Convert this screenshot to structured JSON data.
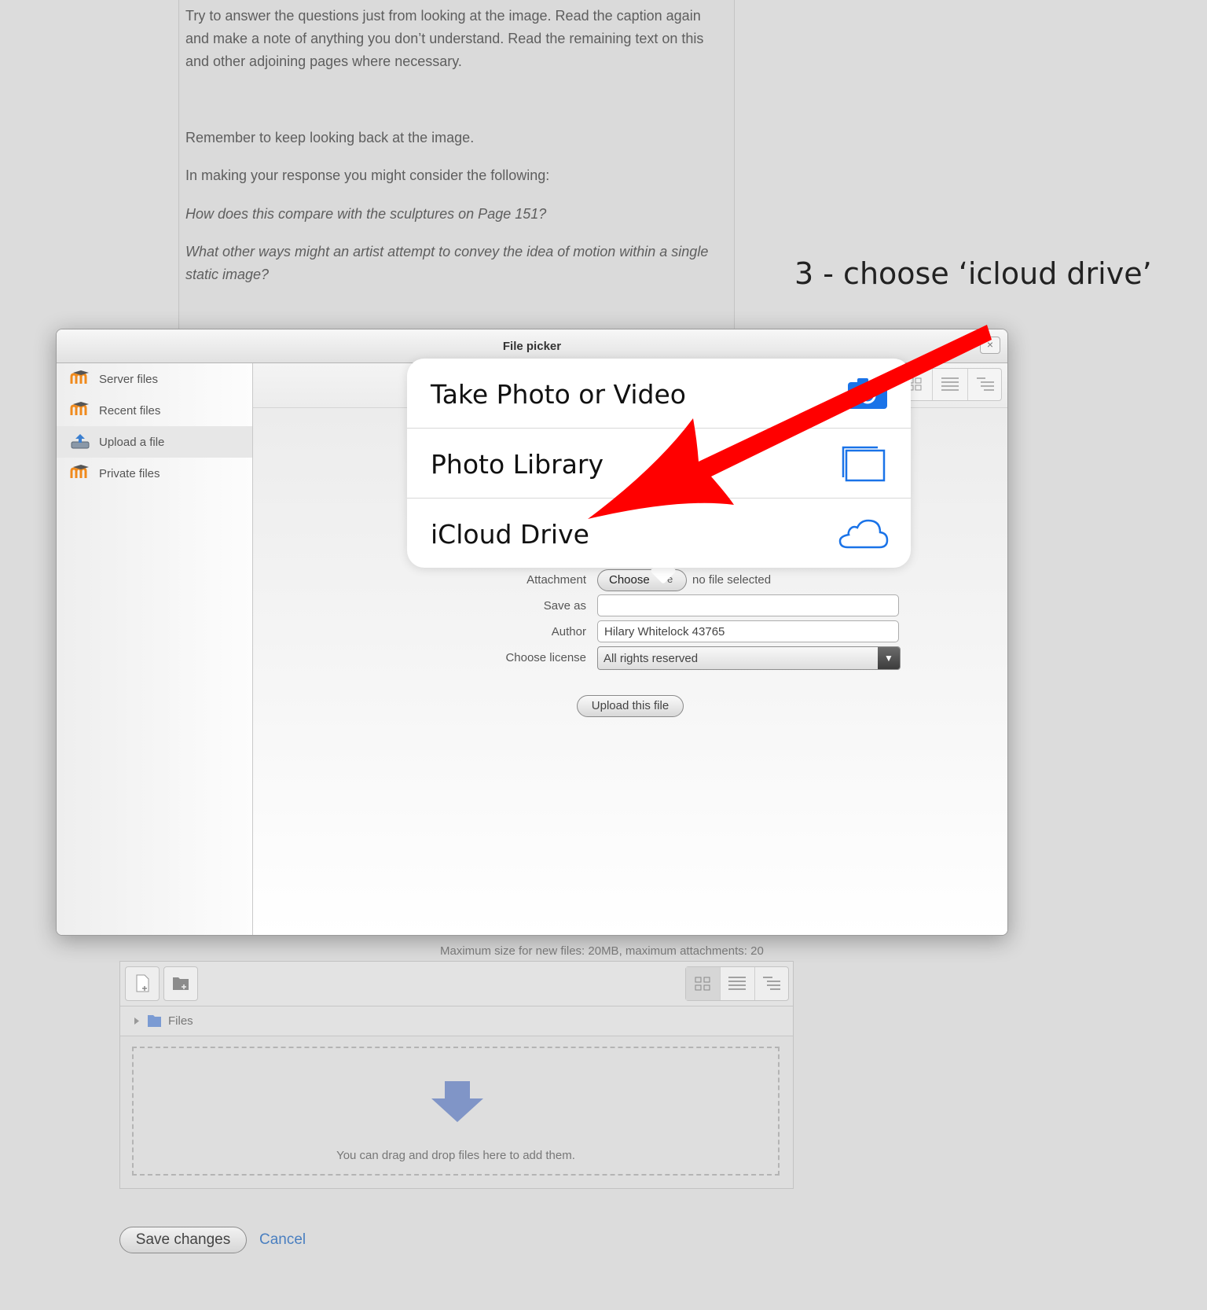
{
  "article": {
    "intro": "Try to answer the questions just from looking at the image. Read the caption again and make a note of anything you don’t understand. Read the remaining text on this and other adjoining pages where necessary.",
    "remember": "Remember to keep looking back at the image.",
    "making": "In making your response you might consider the following:",
    "question1": "How does this compare with the sculptures on Page 151?",
    "question2": "What other ways might an artist attempt to convey the idea of motion within a single static image?"
  },
  "annotation": {
    "text": "3 - choose  ‘icloud drive’",
    "arrow_color": "#ff0000"
  },
  "file_picker": {
    "title": "File picker",
    "close_label": "×",
    "repositories": [
      {
        "label": "Server files",
        "icon": "moodle-icon"
      },
      {
        "label": "Recent files",
        "icon": "moodle-icon"
      },
      {
        "label": "Upload a file",
        "icon": "upload-icon",
        "active": true
      },
      {
        "label": "Private files",
        "icon": "moodle-icon"
      }
    ],
    "form": {
      "attachment_label": "Attachment",
      "choose_button": "Choose",
      "choose_button_hidden_char": "e",
      "no_file_text": "no file selected",
      "save_as_label": "Save as",
      "save_as_value": "",
      "author_label": "Author",
      "author_value": "Hilary Whitelock 43765",
      "license_label": "Choose license",
      "license_value": "All rights reserved",
      "upload_button": "Upload this file"
    }
  },
  "ios_sheet": {
    "options": [
      {
        "label": "Take Photo or Video",
        "icon": "camera-icon"
      },
      {
        "label": "Photo Library",
        "icon": "photo-library-icon"
      },
      {
        "label": "iCloud Drive",
        "icon": "cloud-icon"
      }
    ],
    "accent_color": "#1a73e8"
  },
  "filemanager": {
    "max_size_text": "Maximum size for new files: 20MB, maximum attachments: 20",
    "path_label": "Files",
    "drop_text": "You can drag and drop files here to add them."
  },
  "actions": {
    "save_label": "Save changes",
    "cancel_label": "Cancel"
  }
}
